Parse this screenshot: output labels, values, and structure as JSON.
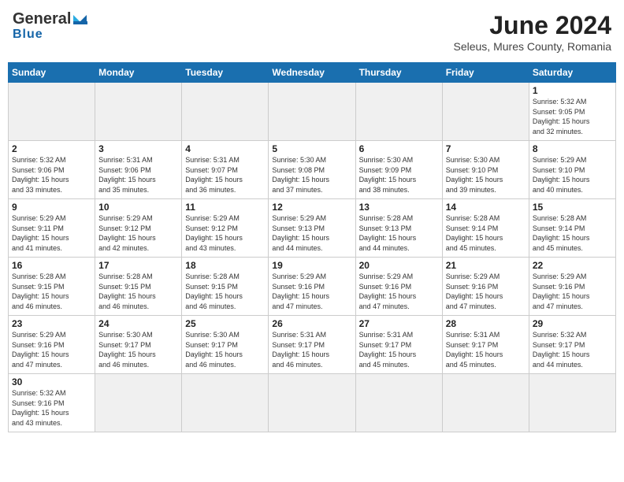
{
  "header": {
    "logo_line1": "General",
    "logo_line2": "Blue",
    "title": "June 2024",
    "subtitle": "Seleus, Mures County, Romania"
  },
  "days_of_week": [
    "Sunday",
    "Monday",
    "Tuesday",
    "Wednesday",
    "Thursday",
    "Friday",
    "Saturday"
  ],
  "weeks": [
    [
      {
        "num": "",
        "info": "",
        "empty": true
      },
      {
        "num": "",
        "info": "",
        "empty": true
      },
      {
        "num": "",
        "info": "",
        "empty": true
      },
      {
        "num": "",
        "info": "",
        "empty": true
      },
      {
        "num": "",
        "info": "",
        "empty": true
      },
      {
        "num": "",
        "info": "",
        "empty": true
      },
      {
        "num": "1",
        "info": "Sunrise: 5:32 AM\nSunset: 9:05 PM\nDaylight: 15 hours\nand 32 minutes."
      }
    ],
    [
      {
        "num": "2",
        "info": "Sunrise: 5:32 AM\nSunset: 9:06 PM\nDaylight: 15 hours\nand 33 minutes."
      },
      {
        "num": "3",
        "info": "Sunrise: 5:31 AM\nSunset: 9:06 PM\nDaylight: 15 hours\nand 35 minutes."
      },
      {
        "num": "4",
        "info": "Sunrise: 5:31 AM\nSunset: 9:07 PM\nDaylight: 15 hours\nand 36 minutes."
      },
      {
        "num": "5",
        "info": "Sunrise: 5:30 AM\nSunset: 9:08 PM\nDaylight: 15 hours\nand 37 minutes."
      },
      {
        "num": "6",
        "info": "Sunrise: 5:30 AM\nSunset: 9:09 PM\nDaylight: 15 hours\nand 38 minutes."
      },
      {
        "num": "7",
        "info": "Sunrise: 5:30 AM\nSunset: 9:10 PM\nDaylight: 15 hours\nand 39 minutes."
      },
      {
        "num": "8",
        "info": "Sunrise: 5:29 AM\nSunset: 9:10 PM\nDaylight: 15 hours\nand 40 minutes."
      }
    ],
    [
      {
        "num": "9",
        "info": "Sunrise: 5:29 AM\nSunset: 9:11 PM\nDaylight: 15 hours\nand 41 minutes."
      },
      {
        "num": "10",
        "info": "Sunrise: 5:29 AM\nSunset: 9:12 PM\nDaylight: 15 hours\nand 42 minutes."
      },
      {
        "num": "11",
        "info": "Sunrise: 5:29 AM\nSunset: 9:12 PM\nDaylight: 15 hours\nand 43 minutes."
      },
      {
        "num": "12",
        "info": "Sunrise: 5:29 AM\nSunset: 9:13 PM\nDaylight: 15 hours\nand 44 minutes."
      },
      {
        "num": "13",
        "info": "Sunrise: 5:28 AM\nSunset: 9:13 PM\nDaylight: 15 hours\nand 44 minutes."
      },
      {
        "num": "14",
        "info": "Sunrise: 5:28 AM\nSunset: 9:14 PM\nDaylight: 15 hours\nand 45 minutes."
      },
      {
        "num": "15",
        "info": "Sunrise: 5:28 AM\nSunset: 9:14 PM\nDaylight: 15 hours\nand 45 minutes."
      }
    ],
    [
      {
        "num": "16",
        "info": "Sunrise: 5:28 AM\nSunset: 9:15 PM\nDaylight: 15 hours\nand 46 minutes."
      },
      {
        "num": "17",
        "info": "Sunrise: 5:28 AM\nSunset: 9:15 PM\nDaylight: 15 hours\nand 46 minutes."
      },
      {
        "num": "18",
        "info": "Sunrise: 5:28 AM\nSunset: 9:15 PM\nDaylight: 15 hours\nand 46 minutes."
      },
      {
        "num": "19",
        "info": "Sunrise: 5:29 AM\nSunset: 9:16 PM\nDaylight: 15 hours\nand 47 minutes."
      },
      {
        "num": "20",
        "info": "Sunrise: 5:29 AM\nSunset: 9:16 PM\nDaylight: 15 hours\nand 47 minutes."
      },
      {
        "num": "21",
        "info": "Sunrise: 5:29 AM\nSunset: 9:16 PM\nDaylight: 15 hours\nand 47 minutes."
      },
      {
        "num": "22",
        "info": "Sunrise: 5:29 AM\nSunset: 9:16 PM\nDaylight: 15 hours\nand 47 minutes."
      }
    ],
    [
      {
        "num": "23",
        "info": "Sunrise: 5:29 AM\nSunset: 9:16 PM\nDaylight: 15 hours\nand 47 minutes."
      },
      {
        "num": "24",
        "info": "Sunrise: 5:30 AM\nSunset: 9:17 PM\nDaylight: 15 hours\nand 46 minutes."
      },
      {
        "num": "25",
        "info": "Sunrise: 5:30 AM\nSunset: 9:17 PM\nDaylight: 15 hours\nand 46 minutes."
      },
      {
        "num": "26",
        "info": "Sunrise: 5:31 AM\nSunset: 9:17 PM\nDaylight: 15 hours\nand 46 minutes."
      },
      {
        "num": "27",
        "info": "Sunrise: 5:31 AM\nSunset: 9:17 PM\nDaylight: 15 hours\nand 45 minutes."
      },
      {
        "num": "28",
        "info": "Sunrise: 5:31 AM\nSunset: 9:17 PM\nDaylight: 15 hours\nand 45 minutes."
      },
      {
        "num": "29",
        "info": "Sunrise: 5:32 AM\nSunset: 9:17 PM\nDaylight: 15 hours\nand 44 minutes."
      }
    ],
    [
      {
        "num": "30",
        "info": "Sunrise: 5:32 AM\nSunset: 9:16 PM\nDaylight: 15 hours\nand 43 minutes."
      },
      {
        "num": "",
        "info": "",
        "empty": true
      },
      {
        "num": "",
        "info": "",
        "empty": true
      },
      {
        "num": "",
        "info": "",
        "empty": true
      },
      {
        "num": "",
        "info": "",
        "empty": true
      },
      {
        "num": "",
        "info": "",
        "empty": true
      },
      {
        "num": "",
        "info": "",
        "empty": true
      }
    ]
  ]
}
